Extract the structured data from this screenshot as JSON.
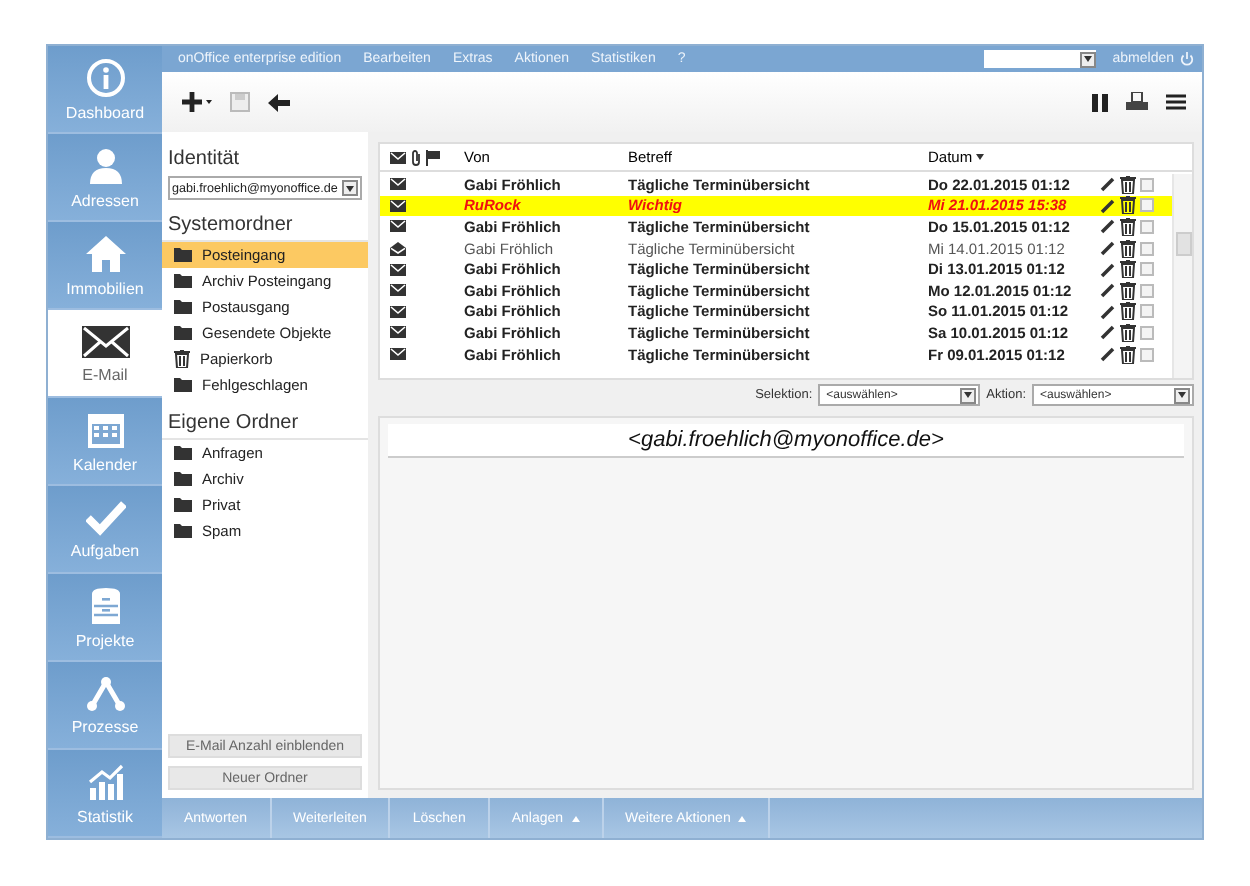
{
  "nav": [
    {
      "label": "Dashboard",
      "kind": "dashboard",
      "selected": false
    },
    {
      "label": "Adressen",
      "kind": "person",
      "selected": false
    },
    {
      "label": "Immobilien",
      "kind": "house",
      "selected": false
    },
    {
      "label": "E-Mail",
      "kind": "mail",
      "selected": true
    },
    {
      "label": "Kalender",
      "kind": "calendar",
      "selected": false
    },
    {
      "label": "Aufgaben",
      "kind": "check",
      "selected": false
    },
    {
      "label": "Projekte",
      "kind": "cabinet",
      "selected": false
    },
    {
      "label": "Prozesse",
      "kind": "nodes",
      "selected": false
    },
    {
      "label": "Statistik",
      "kind": "chart",
      "selected": false
    }
  ],
  "menubar": {
    "items": [
      "onOffice enterprise edition",
      "Bearbeiten",
      "Extras",
      "Aktionen",
      "Statistiken",
      "?"
    ],
    "logout": "abmelden"
  },
  "identity": {
    "label": "Identität",
    "value": "gabi.froehlich@myonoffice.de"
  },
  "system_folders": {
    "title": "Systemordner",
    "items": [
      {
        "label": "Posteingang",
        "kind": "folder",
        "selected": true
      },
      {
        "label": "Archiv Posteingang",
        "kind": "folder",
        "selected": false
      },
      {
        "label": "Postausgang",
        "kind": "folder",
        "selected": false
      },
      {
        "label": "Gesendete Objekte",
        "kind": "folder",
        "selected": false
      },
      {
        "label": "Papierkorb",
        "kind": "trash",
        "selected": false
      },
      {
        "label": "Fehlgeschlagen",
        "kind": "folder",
        "selected": false
      }
    ]
  },
  "own_folders": {
    "title": "Eigene Ordner",
    "items": [
      {
        "label": "Anfragen",
        "kind": "folder",
        "selected": false
      },
      {
        "label": "Archiv",
        "kind": "folder",
        "selected": false
      },
      {
        "label": "Privat",
        "kind": "folder",
        "selected": false
      },
      {
        "label": "Spam",
        "kind": "folder",
        "selected": false
      }
    ]
  },
  "folder_buttons": [
    "E-Mail Anzahl einblenden",
    "Neuer Ordner"
  ],
  "mail_list": {
    "columns": [
      {
        "label": "Von",
        "sorted": false
      },
      {
        "label": "Betreff",
        "sorted": false
      },
      {
        "label": "Datum",
        "sorted": true
      }
    ],
    "rows": [
      {
        "from": "Gabi Fröhlich",
        "subject": "Tägliche Terminübersicht",
        "date": "Do 22.01.2015 01:12",
        "read": false,
        "highlighted": false,
        "checked": false
      },
      {
        "from": "RuRock",
        "subject": "Wichtig",
        "date": "Mi 21.01.2015 15:38",
        "read": false,
        "highlighted": true,
        "checked": false
      },
      {
        "from": "Gabi Fröhlich",
        "subject": "Tägliche Terminübersicht",
        "date": "Do 15.01.2015 01:12",
        "read": false,
        "highlighted": false,
        "checked": false
      },
      {
        "from": "Gabi Fröhlich",
        "subject": "Tägliche Terminübersicht",
        "date": "Mi 14.01.2015 01:12",
        "read": true,
        "highlighted": false,
        "checked": false
      },
      {
        "from": "Gabi Fröhlich",
        "subject": "Tägliche Terminübersicht",
        "date": "Di 13.01.2015 01:12",
        "read": false,
        "highlighted": false,
        "checked": false
      },
      {
        "from": "Gabi Fröhlich",
        "subject": "Tägliche Terminübersicht",
        "date": "Mo 12.01.2015 01:12",
        "read": false,
        "highlighted": false,
        "checked": false
      },
      {
        "from": "Gabi Fröhlich",
        "subject": "Tägliche Terminübersicht",
        "date": "So 11.01.2015 01:12",
        "read": false,
        "highlighted": false,
        "checked": false
      },
      {
        "from": "Gabi Fröhlich",
        "subject": "Tägliche Terminübersicht",
        "date": "Sa 10.01.2015 01:12",
        "read": false,
        "highlighted": false,
        "checked": false
      },
      {
        "from": "Gabi Fröhlich",
        "subject": "Tägliche Terminübersicht",
        "date": "Fr 09.01.2015 01:12",
        "read": false,
        "highlighted": false,
        "checked": false
      }
    ]
  },
  "filters": [
    {
      "label": "Selektion:",
      "value": "<auswählen>"
    },
    {
      "label": "Aktion:",
      "value": "<auswählen>"
    }
  ],
  "preview": {
    "address": "<gabi.froehlich@myonoffice.de>"
  },
  "actions": [
    {
      "label": "Antworten",
      "menu": false
    },
    {
      "label": "Weiterleiten",
      "menu": false
    },
    {
      "label": "Löschen",
      "menu": false
    },
    {
      "label": "Anlagen",
      "menu": true
    },
    {
      "label": "Weitere Aktionen",
      "menu": true
    }
  ]
}
